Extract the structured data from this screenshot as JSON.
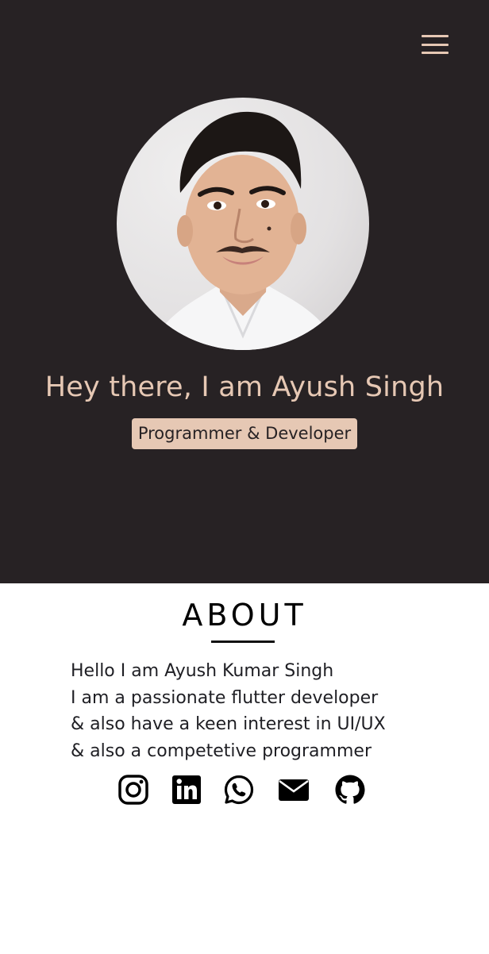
{
  "header": {
    "menu_icon": "hamburger-menu-icon"
  },
  "hero": {
    "title": "Hey there, I am Ayush Singh",
    "role": "Programmer & Developer",
    "colors": {
      "background": "#272224",
      "accent": "#e6c8b4"
    }
  },
  "about": {
    "heading": "ABOUT",
    "lines": [
      "Hello I am Ayush Kumar Singh",
      "I am a passionate flutter developer",
      "& also have a keen interest in UI/UX",
      "& also a competetive programmer"
    ]
  },
  "socials": [
    {
      "icon": "instagram-icon"
    },
    {
      "icon": "linkedin-icon"
    },
    {
      "icon": "whatsapp-icon"
    },
    {
      "icon": "email-icon"
    },
    {
      "icon": "github-icon"
    }
  ]
}
